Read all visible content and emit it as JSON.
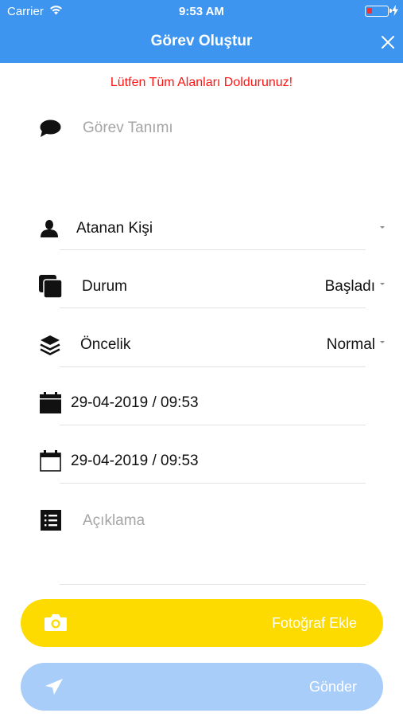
{
  "status_bar": {
    "carrier": "Carrier",
    "time": "9:53 AM"
  },
  "nav": {
    "title": "Görev Oluştur"
  },
  "error_message": "Lütfen Tüm Alanları Doldurunuz!",
  "form": {
    "task_description_placeholder": "Görev Tanımı",
    "assignee_label": "Atanan Kişi",
    "status_label": "Durum",
    "status_value": "Başladı",
    "priority_label": "Öncelik",
    "priority_value": "Normal",
    "start_date": "29-04-2019 / 09:53",
    "end_date": "29-04-2019 / 09:53",
    "notes_placeholder": "Açıklama"
  },
  "buttons": {
    "add_photo": "Fotoğraf Ekle",
    "send": "Gönder"
  },
  "colors": {
    "header": "#3d95ef",
    "error": "#ff1414",
    "photo_button": "#fedb00",
    "send_button": "#a8cdf9"
  },
  "icons": [
    "wifi-icon",
    "battery-icon",
    "charging-icon",
    "close-icon",
    "speech-bubble-icon",
    "person-icon",
    "copy-icon",
    "layers-icon",
    "calendar-filled-icon",
    "calendar-outline-icon",
    "list-icon",
    "camera-icon",
    "send-icon"
  ]
}
